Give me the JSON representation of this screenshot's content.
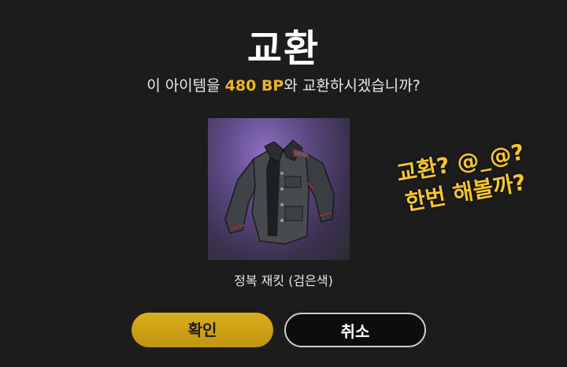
{
  "dialog": {
    "title": "교환",
    "message_before": "이 아이템을 ",
    "price": "480 BP",
    "message_after": "와 교환하시겠습니까?",
    "item": {
      "name": "정복 재킷 (검은색)",
      "icon": "black-jacket-icon"
    },
    "annotation": {
      "line1": "교환? @_@?",
      "line2": "한번 해볼까?"
    },
    "buttons": {
      "confirm_label": "확인",
      "cancel_label": "취소"
    }
  },
  "colors": {
    "background": "#1c1c1d",
    "accent": "#f0b429",
    "confirm_button": "#c9a016",
    "annotation": "#f4c430"
  }
}
